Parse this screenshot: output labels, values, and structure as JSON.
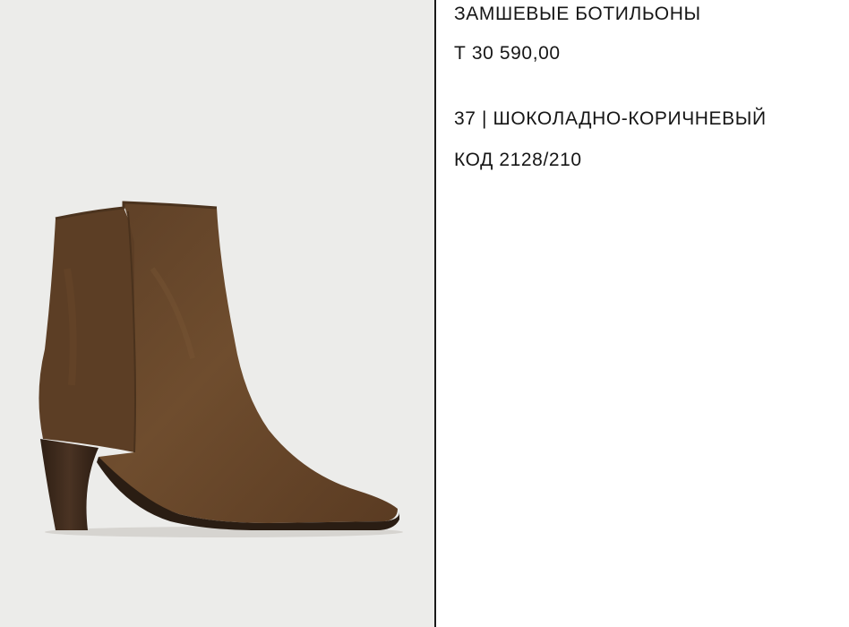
{
  "product": {
    "title": "ЗАМШЕВЫЕ БОТИЛЬОНЫ",
    "price": "Т 30 590,00",
    "variant": "37 | ШОКОЛАДНО-КОРИЧНЕВЫЙ",
    "code": "КОД 2128/210"
  },
  "image": {
    "subject": "brown-suede-ankle-boot",
    "background_color": "#ececea",
    "suede_color": "#6b4a2c",
    "heel_color": "#3d2a1c"
  },
  "colors": {
    "divider": "#1a1a1a",
    "text": "#161616"
  }
}
